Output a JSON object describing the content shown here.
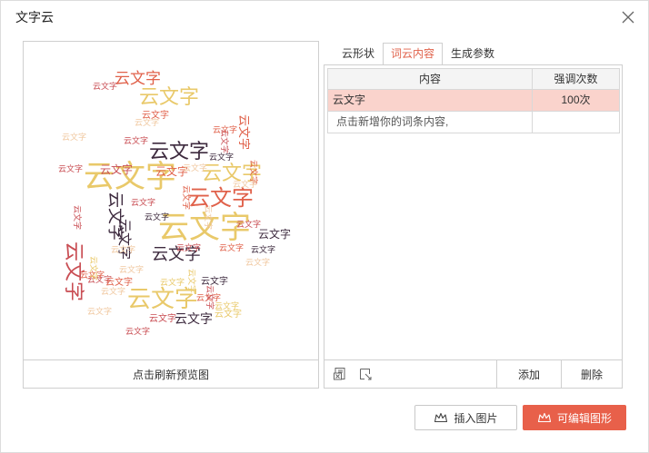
{
  "dialog": {
    "title": "文字云"
  },
  "preview": {
    "cloud_word": "云文字",
    "refresh_label": "点击刷新预览图",
    "palette": [
      "#e9c96a",
      "#e0614a",
      "#3d2a3e",
      "#c94e54",
      "#f0c8a0"
    ]
  },
  "tabs": [
    {
      "label": "云形状",
      "active": false
    },
    {
      "label": "词云内容",
      "active": true
    },
    {
      "label": "生成参数",
      "active": false
    }
  ],
  "table": {
    "headers": {
      "content": "内容",
      "emphasis": "强调次数"
    },
    "rows": [
      {
        "content": "云文字",
        "count": "100次"
      }
    ],
    "placeholder": "点击新增你的词条内容,"
  },
  "footer": {
    "import_icon": "import-excel-icon",
    "clear_icon": "clear-format-icon",
    "add_label": "添加",
    "delete_label": "删除"
  },
  "buttons": {
    "insert_label": "插入图片",
    "edit_label": "可编辑图形"
  },
  "colors": {
    "accent": "#e8604a",
    "selected_row": "#fad3cc"
  }
}
